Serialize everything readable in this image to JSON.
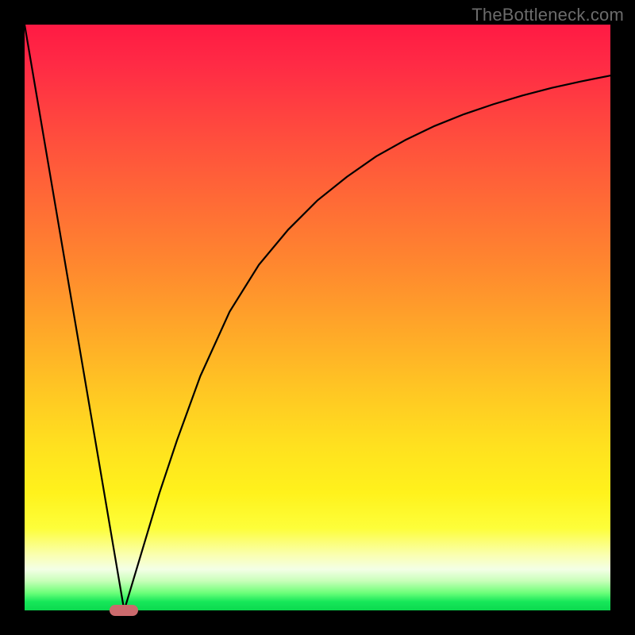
{
  "watermark": "TheBottleneck.com",
  "chart_data": {
    "type": "line",
    "title": "",
    "xlabel": "",
    "ylabel": "",
    "xlim": [
      0,
      100
    ],
    "ylim": [
      0,
      100
    ],
    "grid": false,
    "legend": false,
    "series": [
      {
        "name": "left-segment",
        "x": [
          0,
          17
        ],
        "y": [
          100,
          0
        ]
      },
      {
        "name": "right-curve",
        "x": [
          17,
          20,
          23,
          26,
          30,
          35,
          40,
          45,
          50,
          55,
          60,
          65,
          70,
          75,
          80,
          85,
          90,
          95,
          100
        ],
        "y": [
          0,
          10,
          20,
          29,
          40,
          51,
          59,
          65,
          70,
          74,
          77.5,
          80.3,
          82.7,
          84.7,
          86.4,
          87.9,
          89.2,
          90.3,
          91.3
        ]
      }
    ],
    "marker": {
      "x": 17,
      "y": 0,
      "color": "#cb6a6d"
    },
    "gradient_stops": [
      {
        "pos": 0,
        "color": "#ff1a44"
      },
      {
        "pos": 50,
        "color": "#ffaa28"
      },
      {
        "pos": 82,
        "color": "#fff21c"
      },
      {
        "pos": 100,
        "color": "#0bd94e"
      }
    ]
  }
}
